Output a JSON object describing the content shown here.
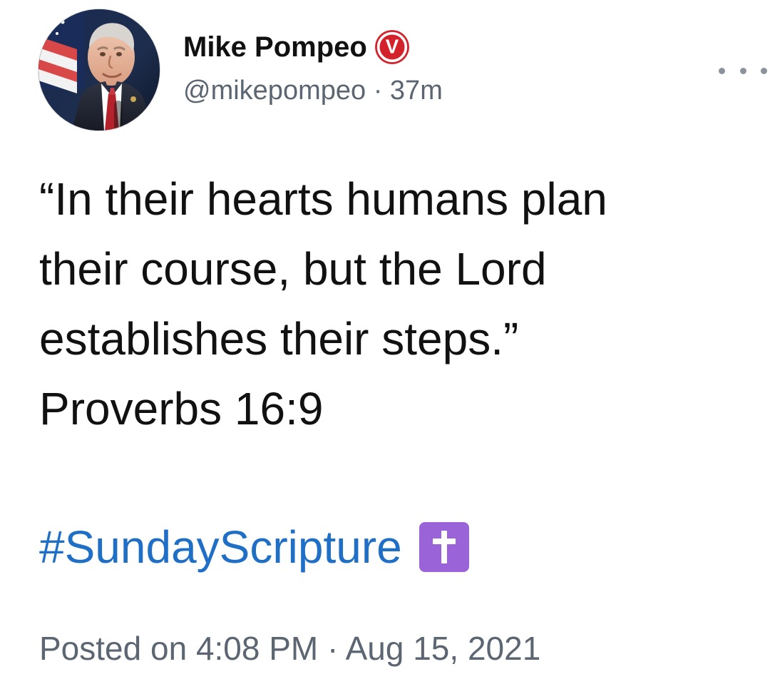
{
  "profile": {
    "name": "Mike Pompeo",
    "badge_label": "V",
    "handle": "@mikepompeo",
    "separator": "·",
    "age": "37m",
    "avatar_icon": "person-portrait-icon",
    "colors": {
      "badge": "#d3222a",
      "meta": "#5b6672"
    }
  },
  "tweet": {
    "lines": [
      "“In their hearts humans plan",
      "their course, but the Lord",
      "establishes their steps.”",
      "Proverbs 16:9"
    ],
    "hashtag": "#SundayScripture",
    "emoji_icon": "latin-cross-icon",
    "colors": {
      "link": "#1f6fc7",
      "emoji_bg": "#9b63d8"
    }
  },
  "posted": {
    "text": "Posted on 4:08 PM · Aug 15, 2021"
  },
  "menu": {
    "icon": "more-options-icon"
  }
}
